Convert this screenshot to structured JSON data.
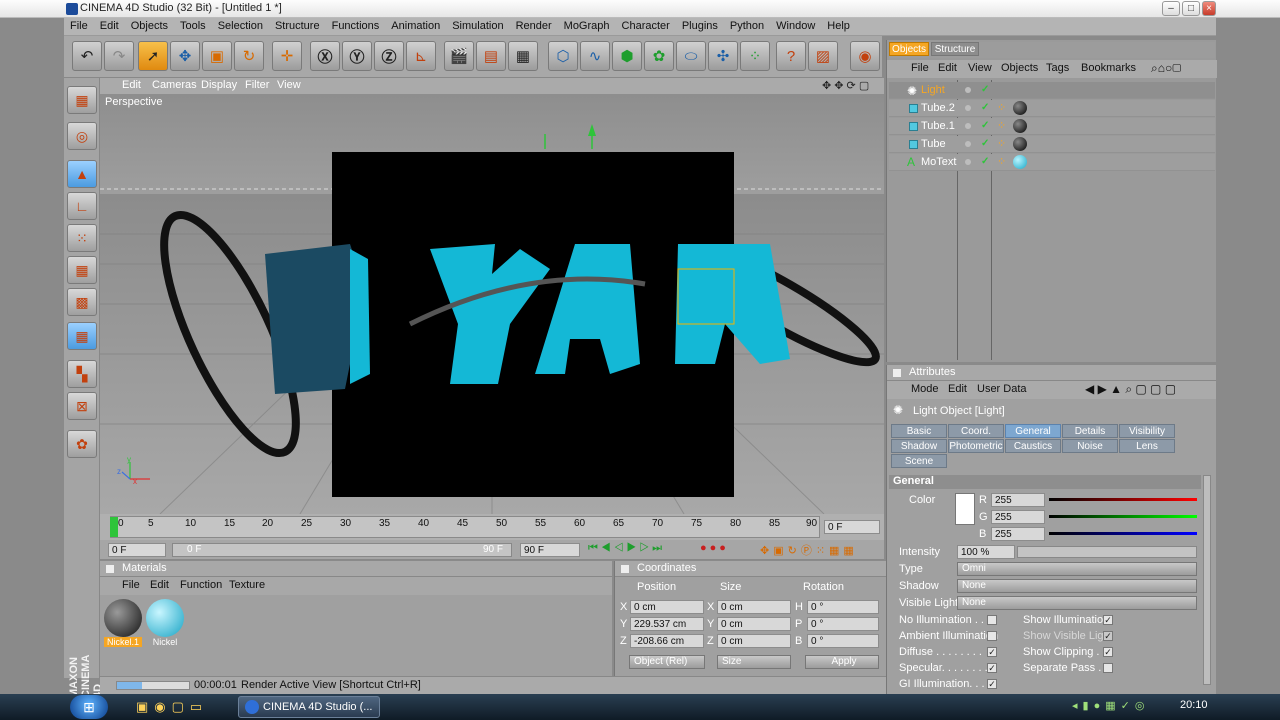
{
  "window": {
    "title": "CINEMA 4D Studio (32 Bit) - [Untitled 1 *]"
  },
  "menu": [
    "File",
    "Edit",
    "Objects",
    "Tools",
    "Selection",
    "Structure",
    "Functions",
    "Animation",
    "Simulation",
    "Render",
    "MoGraph",
    "Character",
    "Plugins",
    "Python",
    "Window",
    "Help"
  ],
  "viewport": {
    "menu": [
      "Edit",
      "Cameras",
      "Display",
      "Filter",
      "View"
    ],
    "label": "Perspective",
    "axis": {
      "x": "x",
      "y": "y",
      "z": "z"
    }
  },
  "timeline": {
    "ticks": [
      "0",
      "5",
      "10",
      "15",
      "20",
      "25",
      "30",
      "35",
      "40",
      "45",
      "50",
      "55",
      "60",
      "65",
      "70",
      "75",
      "80",
      "85",
      "90"
    ],
    "current": "0 F",
    "start": "0 F",
    "range_start": "0 F",
    "range_end": "90 F",
    "end": "90 F"
  },
  "materials": {
    "title": "Materials",
    "menu": [
      "File",
      "Edit",
      "Function",
      "Texture"
    ],
    "items": [
      {
        "name": "Nickel.1"
      },
      {
        "name": "Nickel"
      }
    ]
  },
  "coordinates": {
    "title": "Coordinates",
    "headers": [
      "Position",
      "Size",
      "Rotation"
    ],
    "rows": [
      {
        "axis": "X",
        "pos": "0 cm",
        "saxis": "X",
        "size": "0 cm",
        "raxis": "H",
        "rot": "0 °"
      },
      {
        "axis": "Y",
        "pos": "229.537 cm",
        "saxis": "Y",
        "size": "0 cm",
        "raxis": "P",
        "rot": "0 °"
      },
      {
        "axis": "Z",
        "pos": "-208.66 cm",
        "saxis": "Z",
        "size": "0 cm",
        "raxis": "B",
        "rot": "0 °"
      }
    ],
    "mode": "Object (Rel)",
    "size_mode": "Size",
    "apply": "Apply"
  },
  "status": {
    "time": "00:00:01",
    "message": "Render Active View [Shortcut Ctrl+R]",
    "progress": 0.35
  },
  "objects": {
    "tabs": [
      "Objects",
      "Structure"
    ],
    "menu": [
      "File",
      "Edit",
      "View",
      "Objects",
      "Tags",
      "Bookmarks"
    ],
    "items": [
      {
        "name": "Light",
        "selected": true
      },
      {
        "name": "Tube.2"
      },
      {
        "name": "Tube.1"
      },
      {
        "name": "Tube"
      },
      {
        "name": "MoText"
      }
    ]
  },
  "attributes": {
    "title": "Attributes",
    "menu": [
      "Mode",
      "Edit",
      "User Data"
    ],
    "object": "Light Object [Light]",
    "tabs_row1": [
      "Basic",
      "Coord.",
      "General",
      "Details",
      "Visibility"
    ],
    "tabs_row2": [
      "Shadow",
      "Photometric",
      "Caustics",
      "Noise",
      "Lens"
    ],
    "tabs_row3": [
      "Scene"
    ],
    "section": "General",
    "color_label": "Color",
    "r_label": "R",
    "g_label": "G",
    "b_label": "B",
    "r": "255",
    "g": "255",
    "b": "255",
    "intensity_label": "Intensity",
    "intensity": "100 %",
    "type_label": "Type",
    "type": "Omni",
    "shadow_label": "Shadow",
    "shadow": "None",
    "visible_label": "Visible Light",
    "visible": "None",
    "checks_left": [
      {
        "label": "No Illumination . . . .",
        "checked": false
      },
      {
        "label": "Ambient Illumination",
        "checked": false
      },
      {
        "label": "Diffuse . . . . . . . .",
        "checked": true
      },
      {
        "label": "Specular. . . . . . . .",
        "checked": true
      },
      {
        "label": "GI Illumination. . . .",
        "checked": true
      }
    ],
    "checks_right": [
      {
        "label": "Show Illumination",
        "checked": true
      },
      {
        "label": "Show Visible Light",
        "checked": true
      },
      {
        "label": "Show Clipping . . .",
        "checked": true
      },
      {
        "label": "Separate Pass . . .",
        "checked": false
      }
    ]
  },
  "brand": {
    "line1": "MAXON",
    "line2": "CINEMA 4D"
  },
  "taskbar": {
    "app": "CINEMA 4D Studio (...",
    "clock": "20:10"
  }
}
